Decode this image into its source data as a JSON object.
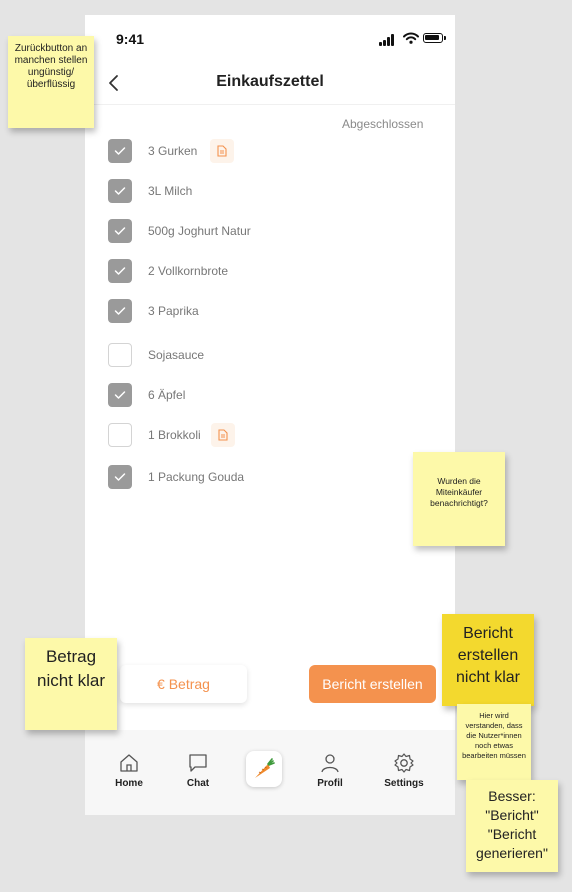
{
  "status_bar": {
    "time": "9:41"
  },
  "header": {
    "title": "Einkaufszettel"
  },
  "section": {
    "label": "Abgeschlossen"
  },
  "items": [
    {
      "label": "3  Gurken",
      "checked": true,
      "has_note": true
    },
    {
      "label": "3L Milch",
      "checked": true,
      "has_note": false
    },
    {
      "label": "500g Joghurt Natur",
      "checked": true,
      "has_note": false
    },
    {
      "label": "2 Vollkornbrote",
      "checked": true,
      "has_note": false
    },
    {
      "label": "3 Paprika",
      "checked": true,
      "has_note": false
    },
    {
      "label": "Sojasauce",
      "checked": false,
      "has_note": false
    },
    {
      "label": "6 Äpfel",
      "checked": true,
      "has_note": false
    },
    {
      "label": "1 Brokkoli",
      "checked": false,
      "has_note": true
    },
    {
      "label": "1 Packung Gouda",
      "checked": true,
      "has_note": false
    }
  ],
  "buttons": {
    "amount": "€ Betrag",
    "report": "Bericht erstellen"
  },
  "tabbar": {
    "home": "Home",
    "chat": "Chat",
    "profile": "Profil",
    "settings": "Settings"
  },
  "stickies": {
    "back_button": "Zurückbutton an manchen stellen ungünstig/überflüssig",
    "notified": "Wurden die Miteinkäufer benachrichtigt?",
    "report_unclear": "Bericht erstellen nicht klar",
    "amount_unclear": "Betrag nicht klar",
    "understood": "Hier wird verstanden, dass die Nutzer*innen noch etwas bearbeiten müssen",
    "better": "Besser: \"Bericht\" \"Bericht generieren\""
  },
  "colors": {
    "accent": "#f4924e",
    "checkbox_checked": "#9a9a9a",
    "sticky_yellow": "#fdf9a9",
    "sticky_highlight": "#f3d92e"
  }
}
